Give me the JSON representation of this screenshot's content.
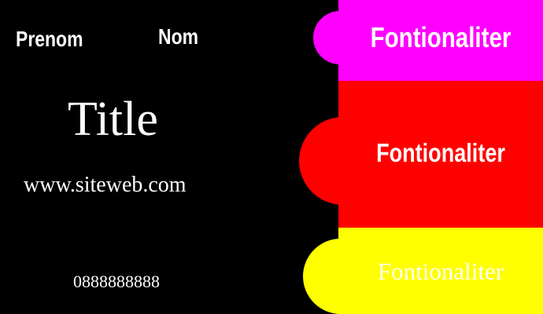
{
  "card": {
    "first_name_label": "Prenom",
    "last_name_label": "Nom",
    "title": "Title",
    "website": "www.siteweb.com",
    "phone": "0888888888"
  },
  "tabs": [
    {
      "label": "Fontionaliter",
      "color": "#ff00ff"
    },
    {
      "label": "Fontionaliter",
      "color": "#ff0000"
    },
    {
      "label": "Fontionaliter",
      "color": "#ffff00"
    }
  ],
  "colors": {
    "background": "#000000",
    "text": "#ffffff"
  }
}
